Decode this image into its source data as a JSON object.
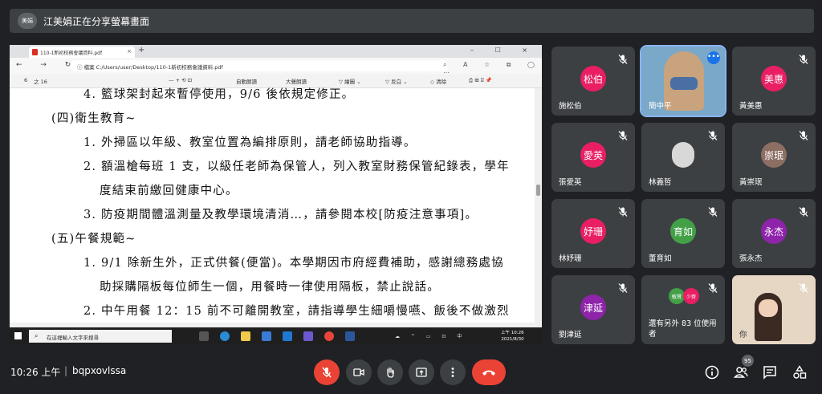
{
  "banner": {
    "badge": "美娟",
    "text": "江美娟正在分享螢幕畫面"
  },
  "browser": {
    "tab_title": "110-1新初校務會議資料.pdf",
    "tab_close": "×",
    "new_tab": "+",
    "window_controls": "– ☐ ×",
    "nav_glyphs": "← → ↻",
    "address_prefix": "ⓘ 檔案",
    "url": "C:/Users/user/Desktop/110-1新初校務會議資料.pdf",
    "right_glyphs": "⌕ A ☆ ⧉ ◯ ⋯"
  },
  "pdf_toolbar": {
    "page": "6",
    "of_pages": "之 16",
    "zoom": "— + ⟲ ⊡",
    "read_aloud": "自動朗讀",
    "read_aloud2": "大聲朗讀",
    "draw": "▽ 繪圖 ⌄",
    "highlight": "▽ 反白 ⌄",
    "erase": "◇ 清除",
    "tools": "⎙ ⊞ ⌸ 📌"
  },
  "document": {
    "lines": [
      "4. 籃球架封起來暫停使用，9/6 後依規定修正。",
      "(四)衛生教育~",
      "1. 外掃區以年級、教室位置為編排原則，請老師協助指導。",
      "2. 額溫槍每班 1 支，以級任老師為保管人，列入教室財務保管紀錄表，學年",
      "度結束前繳回健康中心。",
      "3. 防疫期間體溫測量及教學環境清消…，請參閱本校[防疫注意事項]。",
      "(五)午餐規範~",
      "1. 9/1 除新生外，正式供餐(便當)。本學期因市府經費補助，感謝總務處協",
      "助採購隔板每位師生一個，用餐時一律使用隔板，禁止說話。",
      "2. 中午用餐 12：15 前不可離開教室，請指導學生細嚼慢嚥、飯後不做激烈"
    ]
  },
  "taskbar": {
    "search_placeholder": "在這裡輸入文字來搜尋",
    "tray": "☁ ^ ▭ ⊡ 中",
    "clock_time": "上午 10:26",
    "clock_date": "2021/8/30"
  },
  "participants": [
    {
      "initials": "松伯",
      "name": "施松伯",
      "color": "#e91e63"
    },
    {
      "initials": "",
      "name": "簡中平",
      "color": "#6d8fb6"
    },
    {
      "initials": "美惠",
      "name": "黃美惠",
      "color": "#e91e63"
    },
    {
      "initials": "愛英",
      "name": "張愛英",
      "color": "#e91e63"
    },
    {
      "initials": "",
      "name": "林義哲",
      "color": "#8e8e8e"
    },
    {
      "initials": "崇珉",
      "name": "黃崇珉",
      "color": "#8d6e63"
    },
    {
      "initials": "妤珊",
      "name": "林妤珊",
      "color": "#e91e63"
    },
    {
      "initials": "育如",
      "name": "董育如",
      "color": "#43a047"
    },
    {
      "initials": "永杰",
      "name": "張永杰",
      "color": "#8e24aa"
    },
    {
      "initials": "津延",
      "name": "劉津延",
      "color": "#8e24aa"
    },
    {
      "initials": "",
      "name": "還有另外 83 位使用者",
      "color": "#3c4043"
    },
    {
      "initials": "",
      "name": "你",
      "color": "#e6d6c4"
    }
  ],
  "others_avatars": [
    "敏賢",
    "少齊"
  ],
  "bottom": {
    "time": "10:26 上午",
    "separator": "|",
    "meeting_code": "bqpxovlssa",
    "participant_count": "95"
  },
  "colors": {
    "mute_red": "#ea4335",
    "bg": "#202124",
    "tile": "#3c4043"
  }
}
